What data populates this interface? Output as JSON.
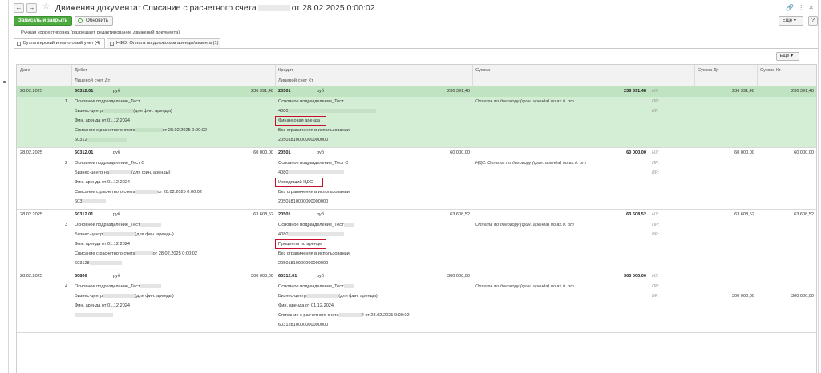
{
  "window": {
    "title": "Движения документа: Списание с расчетного счета",
    "title_suffix": "от 28.02.2025 0:00:02",
    "back_label": "←",
    "forward_label": "→"
  },
  "toolbar": {
    "save_close_label": "Записать и закрыть",
    "refresh_label": "Обновить",
    "more_label": "Еще ▾",
    "help_label": "?"
  },
  "manual_edit_label": "Ручная корректировка (разрешает редактирование движений документа)",
  "tabs": [
    {
      "label": "Бухгалтерский и налоговый учет (4)"
    },
    {
      "label": "НФО: Оплата по договорам аренды/лизинга (1)"
    }
  ],
  "table_more_label": "Еще ▾",
  "columns": {
    "date": "Дата",
    "debit": "Дебет",
    "debit_sub": "Лицевой счет Дт",
    "credit": "Кредит",
    "credit_sub": "Лицевой счет Кт",
    "sum": "Сумма",
    "sum_dt": "Сумма Дт",
    "sum_kt": "Сумма Кт"
  },
  "records": [
    {
      "date": "28.02.2025",
      "num": "1",
      "dt_account": "60312.01",
      "dt_currency": "руб",
      "dt_amount": "236 391,48",
      "dt_lines": [
        "Основное подразделение_Тест",
        "Бизнес-центр",
        "(для фин. аренды)",
        "Фин. аренда от 01.12.2024",
        "Списание с расчетного счета",
        "от 28.02.2025 0:00:02",
        "60312"
      ],
      "kt_account": "20501",
      "kt_currency": "руб",
      "kt_amount": "236 391,48",
      "kt_lines": [
        "Основное подразделение_Тест",
        "4080",
        "Финансовая аренда",
        "Без ограничения в использовании",
        "20501810000000000000"
      ],
      "sum": "236 391,48",
      "content": "Оплата по договору (фин. аренда) по вх.д.   от",
      "nu": "НУ:",
      "pr": "ПР:",
      "vr": "ВР:",
      "sum_dt": "236 391,48",
      "sum_kt": "236 391,48"
    },
    {
      "date": "28.02.2025",
      "num": "2",
      "dt_account": "60312.01",
      "dt_currency": "руб",
      "dt_amount": "60 000,00",
      "dt_lines": [
        "Основное подразделение_Тест С",
        "Бизнес-центр на",
        "(для фин. аренды)",
        "Фин. аренда от 01.12.2024",
        "Списание с расчетного счета",
        "от 28.02.2025 0:00:02",
        "603"
      ],
      "kt_account": "20501",
      "kt_currency": "руб",
      "kt_amount": "60 000,00",
      "kt_lines": [
        "Основное подразделение_Тест С",
        "4080",
        "Исходящий НДС",
        "Без ограничения в использовании",
        "20501810000000000000"
      ],
      "sum": "60 000,00",
      "content": "НДС. Оплата по договору (фин. аренда) по вх.д.   от",
      "nu": "НУ:",
      "pr": "ПР:",
      "vr": "ВР:",
      "sum_dt": "60 000,00",
      "sum_kt": "60 000,00"
    },
    {
      "date": "28.02.2025",
      "num": "3",
      "dt_account": "60312.01",
      "dt_currency": "руб",
      "dt_amount": "63 608,52",
      "dt_lines": [
        "Основное подразделение_Тест",
        "Бизнес-центр",
        "(для фин. аренды)",
        "Фин. аренда от 01.12.2024",
        "Списание с расчетного счета",
        "от 28.02.2025 0:00:02",
        "603128"
      ],
      "kt_account": "20501",
      "kt_currency": "руб",
      "kt_amount": "63 608,52",
      "kt_lines": [
        "Основное подразделение_Тест",
        "4080",
        "Проценты по аренде",
        "Без ограничения в использовании",
        "20501810000000000000"
      ],
      "sum": "63 608,52",
      "content": "Оплата по договору (фин. аренда) по вх.д.   от",
      "nu": "НУ:",
      "pr": "ПР:",
      "vr": "ВР:",
      "sum_dt": "63 608,52",
      "sum_kt": "63 608,52"
    },
    {
      "date": "28.02.2025",
      "num": "4",
      "dt_account": "60806",
      "dt_currency": "руб",
      "dt_amount": "300 000,00",
      "dt_lines": [
        "Основное подразделение_Тест",
        "Бизнес-центр",
        "(для фин. аренды)",
        "Фин. аренда от 01.12.2024"
      ],
      "kt_account": "60312.01",
      "kt_currency": "руб",
      "kt_amount": "300 000,00",
      "kt_lines": [
        "Основное подразделение_Тест",
        "Бизнес-центр",
        "(для фин. аренды)",
        "Фин. аренда от 01.12.2024",
        "Списание с расчетного счета",
        "2 от 28.02.2025 0:00:02",
        "60312810000000000000"
      ],
      "sum": "300 000,00",
      "content": "Оплата по договору (фин. аренда) по вх.д.   от",
      "nu": "НУ:",
      "pr": "ПР:",
      "vr": "ВР:",
      "sum_dt": "300 000,00",
      "sum_kt": "300 000,00"
    }
  ]
}
